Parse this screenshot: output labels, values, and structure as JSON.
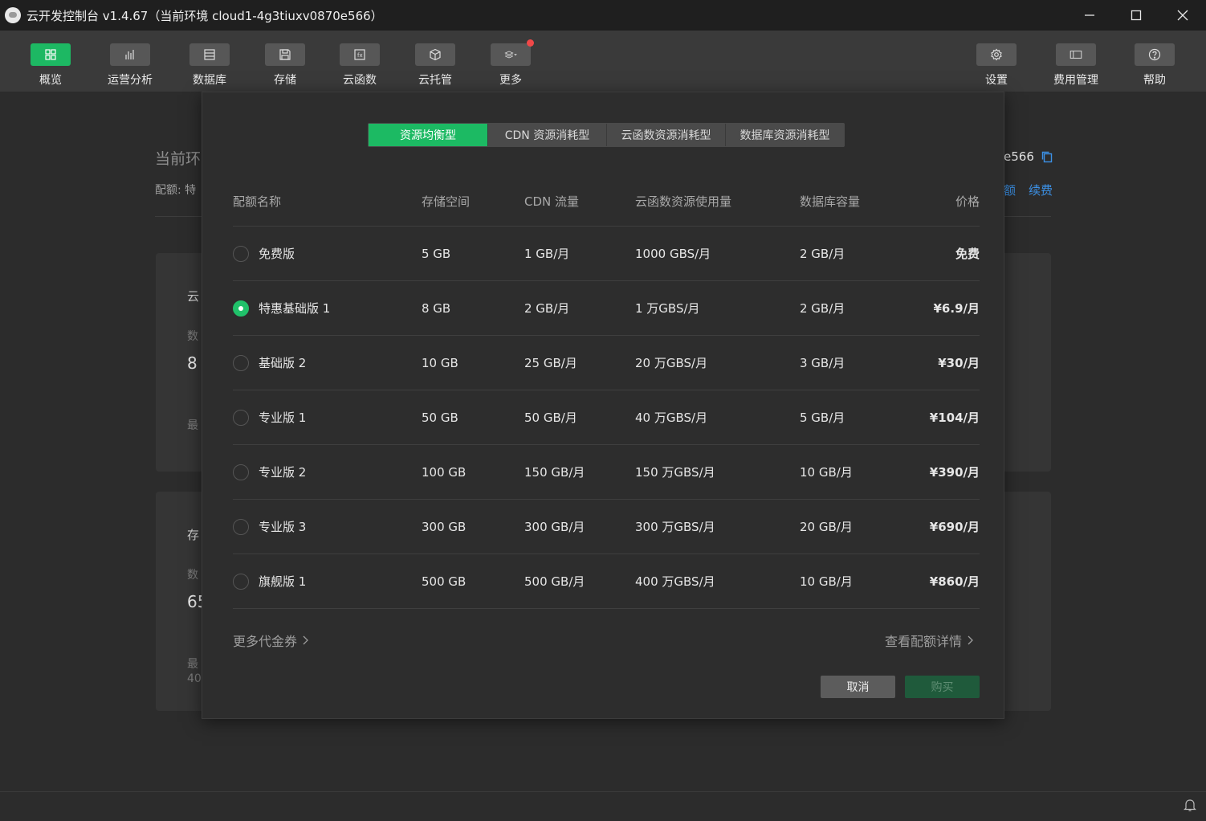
{
  "window": {
    "title": "云开发控制台 v1.4.67（当前环境 cloud1-4g3tiuxv0870e566）"
  },
  "toolbar": {
    "items": [
      {
        "label": "概览",
        "icon": "grid-icon"
      },
      {
        "label": "运营分析",
        "icon": "bar-chart-icon"
      },
      {
        "label": "数据库",
        "icon": "database-icon"
      },
      {
        "label": "存储",
        "icon": "storage-icon"
      },
      {
        "label": "云函数",
        "icon": "function-icon"
      },
      {
        "label": "云托管",
        "icon": "cube-icon"
      },
      {
        "label": "更多",
        "icon": "layers-icon"
      }
    ],
    "right": [
      {
        "label": "设置",
        "icon": "gear-icon"
      },
      {
        "label": "费用管理",
        "icon": "billing-icon"
      },
      {
        "label": "帮助",
        "icon": "help-icon"
      }
    ],
    "accent": "#1db863"
  },
  "background": {
    "title": "当前环",
    "sub": "配额: 特",
    "env_suffix": "e566",
    "links": [
      "额",
      "续费"
    ],
    "card1": [
      "云",
      "数",
      "8",
      "最"
    ],
    "card2": [
      "存",
      "数",
      "65",
      "最",
      "40"
    ]
  },
  "modal": {
    "tabs": [
      "资源均衡型",
      "CDN 资源消耗型",
      "云函数资源消耗型",
      "数据库资源消耗型"
    ],
    "active_tab": 0,
    "columns": [
      "配额名称",
      "存储空间",
      "CDN 流量",
      "云函数资源使用量",
      "数据库容量",
      "价格"
    ],
    "rows": [
      {
        "name": "免费版",
        "storage": "5 GB",
        "cdn": "1 GB/月",
        "func": "1000 GBS/月",
        "db": "2 GB/月",
        "price": "免费"
      },
      {
        "name": "特惠基础版 1",
        "storage": "8 GB",
        "cdn": "2 GB/月",
        "func": "1 万GBS/月",
        "db": "2 GB/月",
        "price": "¥6.9/月"
      },
      {
        "name": "基础版 2",
        "storage": "10 GB",
        "cdn": "25 GB/月",
        "func": "20 万GBS/月",
        "db": "3 GB/月",
        "price": "¥30/月"
      },
      {
        "name": "专业版 1",
        "storage": "50 GB",
        "cdn": "50 GB/月",
        "func": "40 万GBS/月",
        "db": "5 GB/月",
        "price": "¥104/月"
      },
      {
        "name": "专业版 2",
        "storage": "100 GB",
        "cdn": "150 GB/月",
        "func": "150 万GBS/月",
        "db": "10 GB/月",
        "price": "¥390/月"
      },
      {
        "name": "专业版 3",
        "storage": "300 GB",
        "cdn": "300 GB/月",
        "func": "300 万GBS/月",
        "db": "20 GB/月",
        "price": "¥690/月"
      },
      {
        "name": "旗舰版 1",
        "storage": "500 GB",
        "cdn": "500 GB/月",
        "func": "400 万GBS/月",
        "db": "10 GB/月",
        "price": "¥860/月"
      }
    ],
    "selected_row": 1,
    "more_coupons": "更多代金券",
    "quota_details": "查看配额详情",
    "cancel_label": "取消",
    "buy_label": "购买"
  }
}
